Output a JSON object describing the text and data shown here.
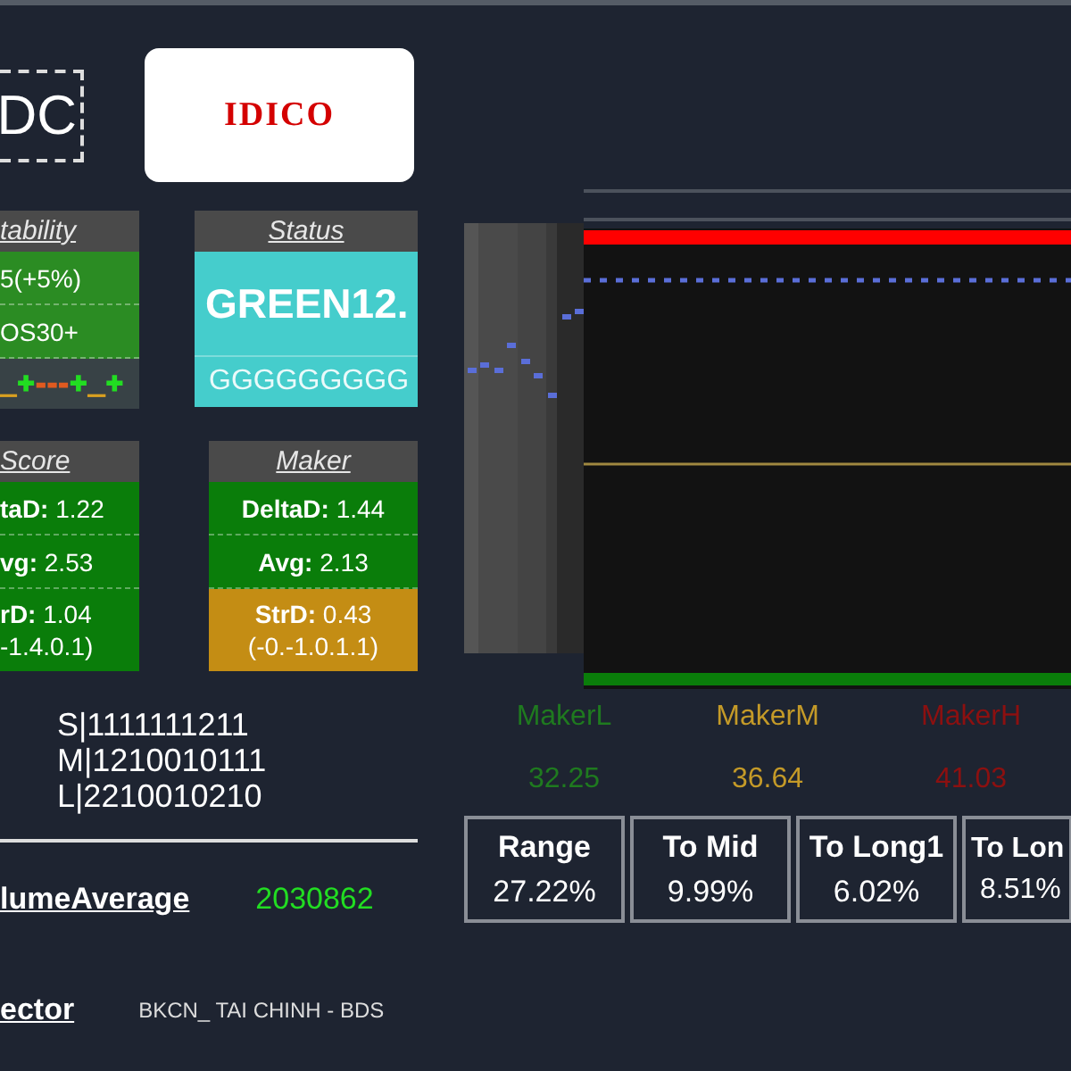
{
  "logo_badge": {
    "text": "DC"
  },
  "company_logo": {
    "text": "IDICO"
  },
  "stability": {
    "title": "tability",
    "rows": [
      {
        "text": "5(+5%)",
        "color": "#2b8c23"
      },
      {
        "text": "OS30+",
        "color": "#2b8c23"
      }
    ],
    "pattern": [
      {
        "text": "_",
        "color": "#d9a020"
      },
      {
        "text": "+",
        "color": "#22dd22"
      },
      {
        "text": "---",
        "color": "#e05a20"
      },
      {
        "text": "+",
        "color": "#22dd22"
      },
      {
        "text": "_",
        "color": "#d9a020"
      },
      {
        "text": "+",
        "color": "#22dd22"
      }
    ]
  },
  "status": {
    "title": "Status",
    "value": "GREEN12.",
    "code": "GGGGGGGGG",
    "color": "#45cdcc"
  },
  "score": {
    "title": "Score",
    "rows": [
      {
        "text": "**taD:** 1.22",
        "color": "#0a7d0a"
      },
      {
        "text": "**vg:** 2.53",
        "color": "#0a7d0a"
      },
      {
        "text": "**rD:** 1.04",
        "sub": "-1.4.0.1)",
        "color": "#0a7d0a"
      }
    ]
  },
  "maker": {
    "title": "Maker",
    "rows": [
      {
        "text": "**DeltaD:** 1.44",
        "color": "#0a7d0a"
      },
      {
        "text": "**Avg:** 2.13",
        "color": "#0a7d0a"
      },
      {
        "text": "**StrD:** 0.43",
        "sub": "(-0.-1.0.1.1)",
        "color": "#c48d14"
      }
    ]
  },
  "codes": [
    "S|1111111211",
    "M|1210010111",
    "L|2210010210"
  ],
  "volume_average": {
    "label": "lumeAverage",
    "value": "2030862"
  },
  "sector": {
    "label": "ector",
    "value": "BKCN_ TAI CHINH - BDS"
  },
  "makers": [
    {
      "label": "MakerL",
      "value": "32.25",
      "color": "#1f7a1f"
    },
    {
      "label": "MakerM",
      "value": "36.64",
      "color": "#c49a28"
    },
    {
      "label": "MakerH",
      "value": "41.03",
      "color": "#8c1010"
    }
  ],
  "metrics": [
    {
      "label": "Range",
      "value": "27.22%"
    },
    {
      "label": "To Mid",
      "value": "9.99%"
    },
    {
      "label": "To Long1",
      "value": "6.02%"
    },
    {
      "label": "To Lon",
      "value": "8.51%"
    }
  ]
}
